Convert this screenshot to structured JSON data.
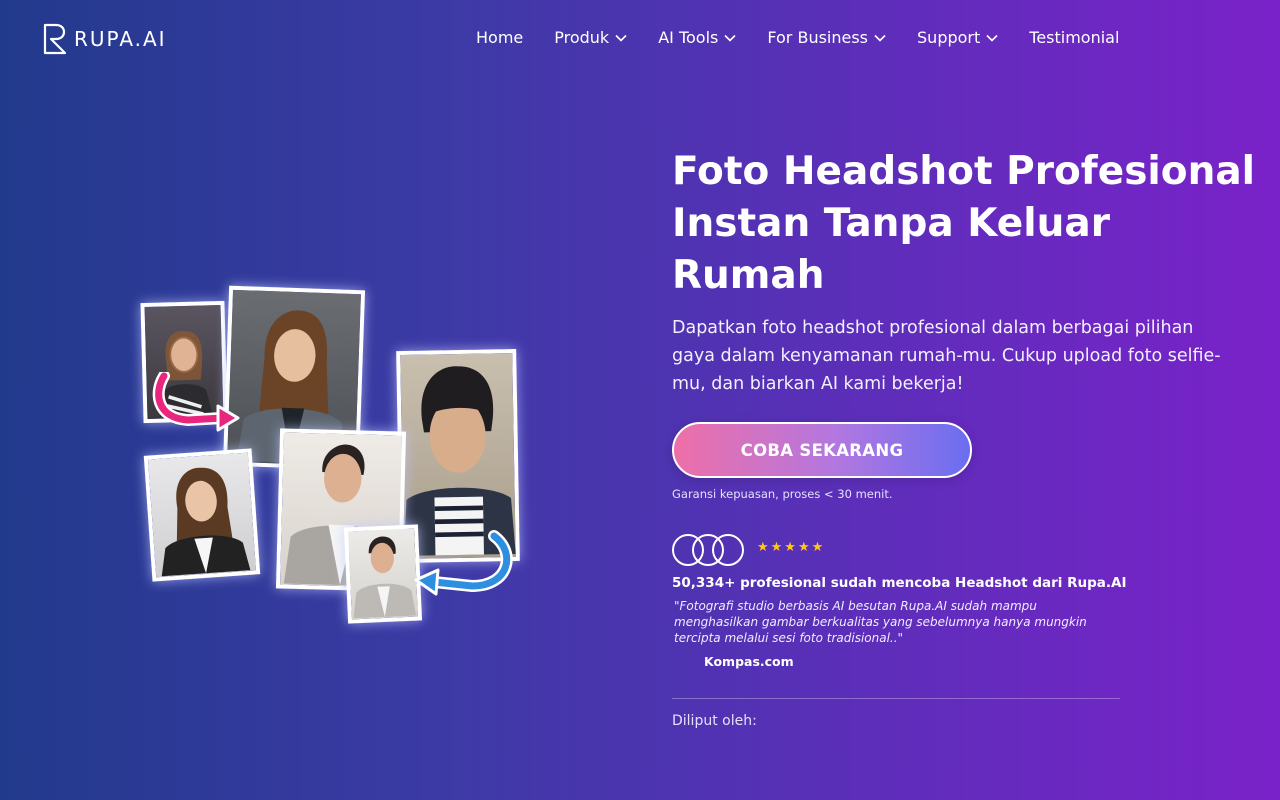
{
  "brand": {
    "name": "RUPA.AI"
  },
  "nav": {
    "items": [
      {
        "label": "Home",
        "dropdown": false
      },
      {
        "label": "Produk",
        "dropdown": true
      },
      {
        "label": "AI Tools",
        "dropdown": true
      },
      {
        "label": "For Business",
        "dropdown": true
      },
      {
        "label": "Support",
        "dropdown": true
      },
      {
        "label": "Testimonial",
        "dropdown": false
      }
    ]
  },
  "hero": {
    "title_line1": "Foto Headshot Profesional",
    "title_line2": "Instan Tanpa Keluar",
    "title_line3": "Rumah",
    "description": "Dapatkan foto headshot profesional dalam berbagai pilihan gaya dalam kenyamanan rumah-mu. Cukup upload foto selfie-mu, dan biarkan AI kami bekerja!",
    "cta_label": "COBA SEKARANG",
    "guarantee": "Garansi kepuasan, proses < 30 menit."
  },
  "social_proof": {
    "stars": "★★★★★",
    "rating": 5,
    "count_text": "50,334+ profesional sudah mencoba Headshot dari Rupa.AI",
    "quote": "\"Fotografi studio berbasis AI besutan Rupa.AI sudah mampu menghasilkan gambar berkualitas yang sebelumnya hanya mungkin tercipta melalui sesi foto tradisional..\"",
    "source": "Kompas.com"
  },
  "covered": {
    "label": "Diliput oleh:"
  },
  "colors": {
    "accent_star": "#ffc61a",
    "cta_start": "#ee6fa8",
    "cta_end": "#6a6ef0",
    "arrow_pink": "#e8267e",
    "arrow_blue": "#2e8fe0"
  }
}
